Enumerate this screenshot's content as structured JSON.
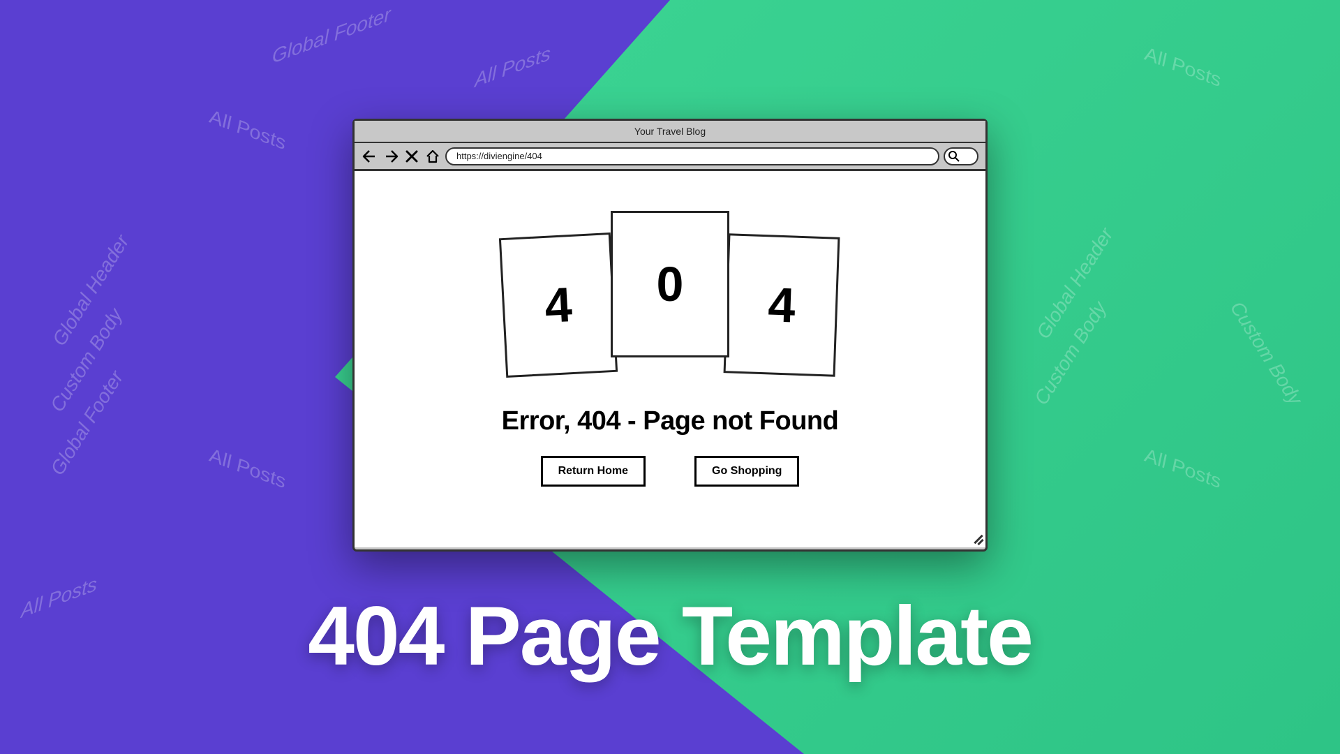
{
  "background": {
    "labels": {
      "all_posts": "All Posts",
      "global_header": "Global Header",
      "global_footer": "Global Footer",
      "custom_body": "Custom Body"
    }
  },
  "browser": {
    "title": "Your Travel Blog",
    "url": "https://diviengine/404"
  },
  "content": {
    "digits": {
      "left": "4",
      "center": "0",
      "right": "4"
    },
    "error_message": "Error, 404 - Page not Found",
    "buttons": {
      "return_home": "Return Home",
      "go_shopping": "Go Shopping"
    }
  },
  "headline": "404 Page Template"
}
